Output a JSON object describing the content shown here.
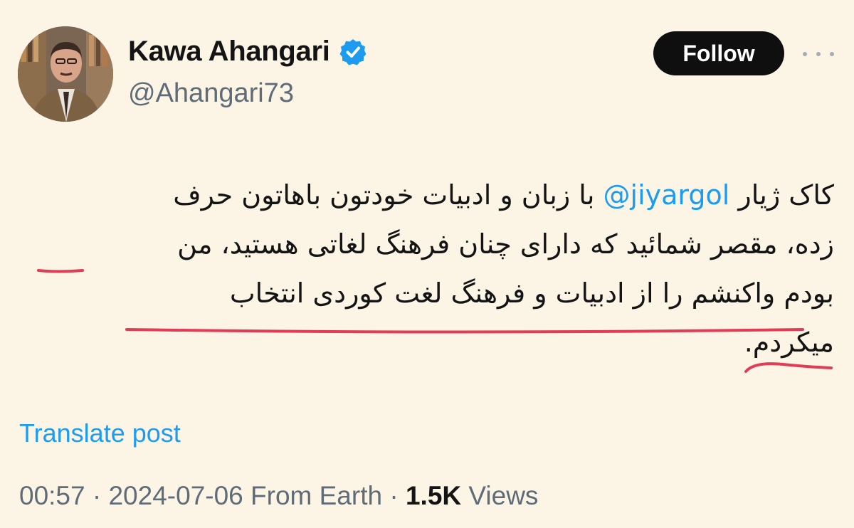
{
  "author": {
    "display_name": "Kawa Ahangari",
    "handle": "@Ahangari73",
    "verified": true,
    "avatar_icon": "profile-photo"
  },
  "actions": {
    "follow_label": "Follow",
    "more_icon": "more-horizontal-icon"
  },
  "post": {
    "lines": [
      {
        "before": "کاک ژیار ",
        "mention": "@jiyargol",
        "after": " با زبان و ادبیات خودتون باهاتون حرف"
      },
      {
        "text": "زده، مقصر شمائید که دارای چنان فرهنگ لغاتی هستید، من"
      },
      {
        "text": "بودم واکنشم را از ادبیات و فرهنگ لغت کوردی انتخاب"
      },
      {
        "text": "میکردم."
      }
    ],
    "translate_label": "Translate post"
  },
  "meta": {
    "time": "00:57",
    "separator": "·",
    "date": "2024-07-06",
    "source": "From Earth",
    "views_count": "1.5K",
    "views_label": "Views"
  },
  "colors": {
    "background": "#fcf5e6",
    "link": "#1d9bf0",
    "muted": "#5f6c78",
    "follow_bg": "#0f0f0f",
    "underline": "#e23b56"
  }
}
